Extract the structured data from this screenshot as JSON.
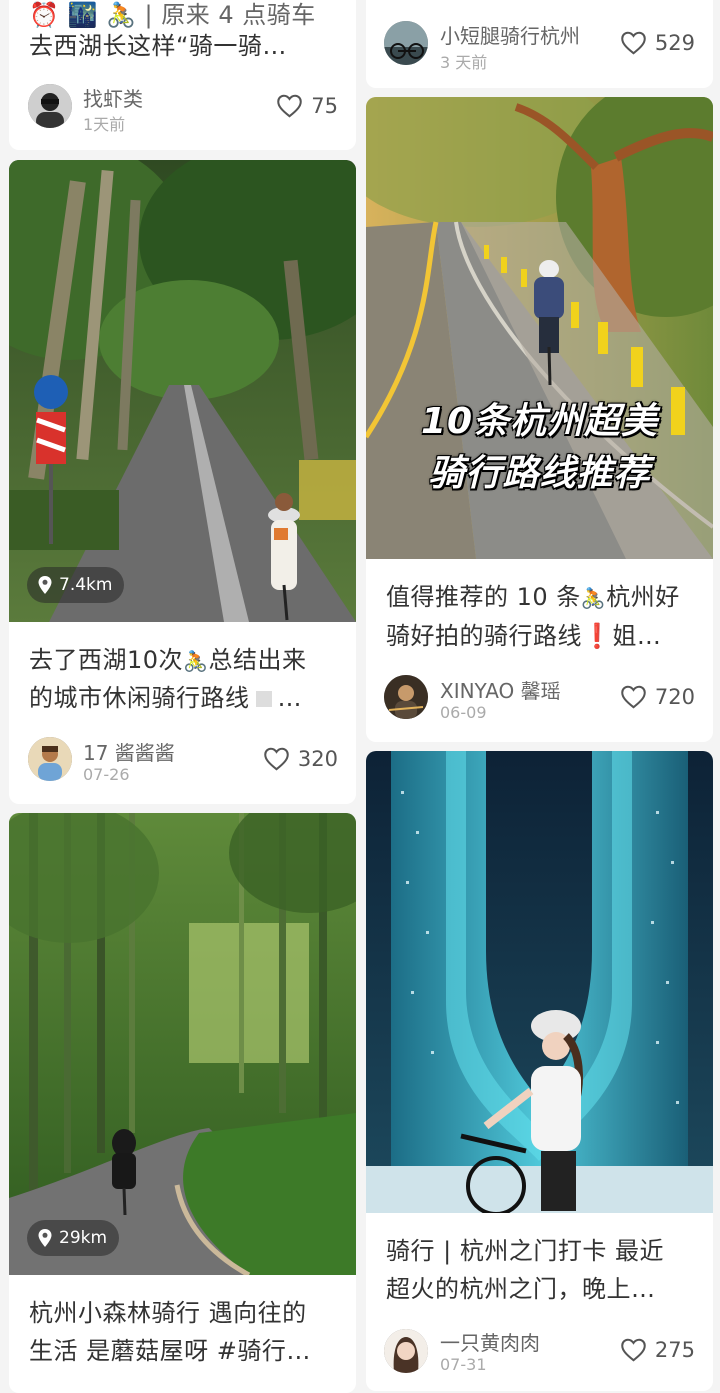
{
  "feed": {
    "left": [
      {
        "title_line1": "⏰ 🌃 🚴 | 原来 4 点骑车",
        "title_line2": "去西湖长这样“骑一骑…",
        "author": "找虾类",
        "time": "1天前",
        "likes": "75"
      },
      {
        "distance": "7.4km",
        "title_line1_a": "去了西湖10次",
        "title_line1_b": "🚴",
        "title_line1_c": "总结出来",
        "title_line2": "的城市休闲骑行路线",
        "title_line2_tail": "…",
        "author": "17 酱酱酱",
        "time": "07-26",
        "likes": "320"
      },
      {
        "distance": "29km",
        "title_line1": "杭州小森林骑行 遇向往的",
        "title_line2": "生活 是蘑菇屋呀 #骑行…"
      }
    ],
    "right": [
      {
        "author": "小短腿骑行杭州",
        "time": "3 天前",
        "likes": "529"
      },
      {
        "overlay_line1": "10条杭州超美",
        "overlay_line2": "骑行路线推荐",
        "title_line1_a": "值得推荐的 10 条",
        "title_line1_b": "🚴",
        "title_line1_c": "杭州好",
        "title_line2_a": "骑好拍的骑行路线",
        "title_line2_b": "❗",
        "title_line2_c": "姐…",
        "author": "XINYAO 馨瑶",
        "time": "06-09",
        "likes": "720"
      },
      {
        "title_line1": "骑行 | 杭州之门打卡 最近",
        "title_line2": "超火的杭州之门，晚上…",
        "author": "一只黄肉肉",
        "time": "07-31",
        "likes": "275"
      }
    ]
  },
  "icons": {
    "heart": "heart-outline-icon",
    "location": "location-pin-icon"
  },
  "colors": {
    "background": "#f4f4f4",
    "card": "#ffffff",
    "title_text": "#333333",
    "meta_text": "#aaaaaa"
  }
}
